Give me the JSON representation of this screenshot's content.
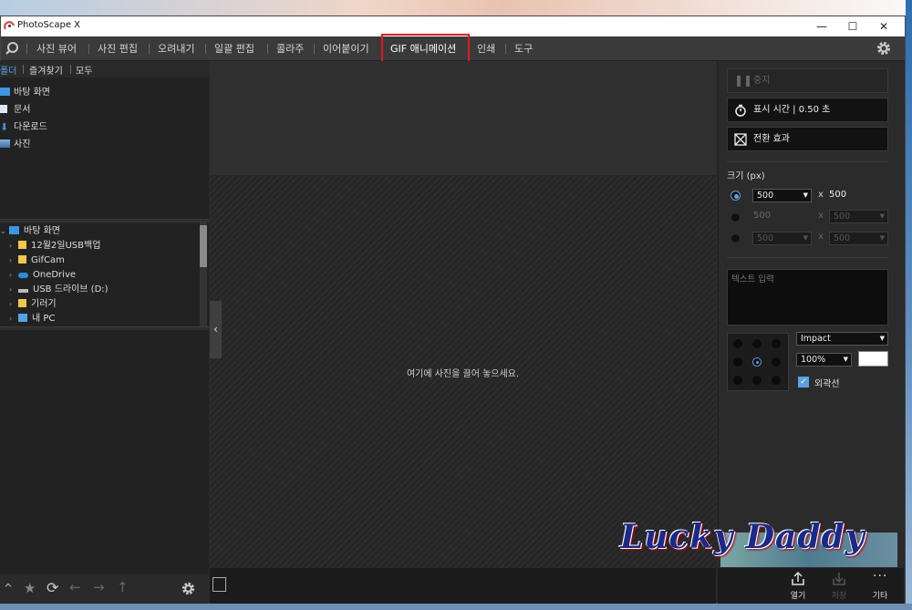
{
  "app": {
    "title": "PhotoScape X"
  },
  "window_controls": {
    "minimize": "—",
    "maximize": "☐",
    "close": "✕"
  },
  "menu": {
    "items": [
      {
        "label": "사진 뷰어"
      },
      {
        "label": "사진 편집"
      },
      {
        "label": "오려내기"
      },
      {
        "label": "일괄 편집"
      },
      {
        "label": "콜라주"
      },
      {
        "label": "이어붙이기"
      },
      {
        "label": "GIF 애니메이션",
        "active": true
      },
      {
        "label": "인쇄"
      },
      {
        "label": "도구"
      }
    ]
  },
  "left_panel": {
    "tabs": [
      "폴더",
      "즐겨찾기",
      "모두"
    ],
    "quick_access": [
      {
        "label": "바탕 화면",
        "icon": "desktop-icon"
      },
      {
        "label": "문서",
        "icon": "document-icon"
      },
      {
        "label": "다운로드",
        "icon": "download-icon"
      },
      {
        "label": "사진",
        "icon": "pictures-icon"
      }
    ],
    "tree": {
      "root": "바탕 화면",
      "children": [
        {
          "label": "12월2일USB백업",
          "icon": "folder-icon"
        },
        {
          "label": "GifCam",
          "icon": "folder-icon"
        },
        {
          "label": "OneDrive",
          "icon": "cloud-icon"
        },
        {
          "label": "USB 드라이브 (D:)",
          "icon": "drive-icon"
        },
        {
          "label": "기러기",
          "icon": "folder-icon"
        },
        {
          "label": "내 PC",
          "icon": "pc-icon"
        }
      ]
    }
  },
  "center": {
    "drop_hint": "여기에 사진을 끌어 놓으세요."
  },
  "right_panel": {
    "pause_label": "중지",
    "display_time_label": "표시 시간 | 0.50 초",
    "transition_label": "전환 효과",
    "size_label": "크기 (px)",
    "size_rows": [
      {
        "width": "500",
        "height": "500",
        "selected": true
      },
      {
        "width": "500",
        "height": "500",
        "selected": false
      },
      {
        "width": "500",
        "height": "500",
        "selected": false
      }
    ],
    "x_symbol": "x",
    "text_placeholder": "텍스트 입력",
    "font": "Impact",
    "zoom": "100%",
    "outline_label": "외곽선",
    "outline_checked": true,
    "text_color": "#ffffff",
    "alignment_selected": "center"
  },
  "bottom_bar": {
    "open_label": "열기",
    "save_label": "저장",
    "more_label": "기타"
  },
  "watermark": {
    "text": "Lucky Daddy"
  },
  "colors": {
    "accent": "#5aa2e3",
    "highlight_box": "#e0191f",
    "panel_bg": "#2a2a2a"
  }
}
